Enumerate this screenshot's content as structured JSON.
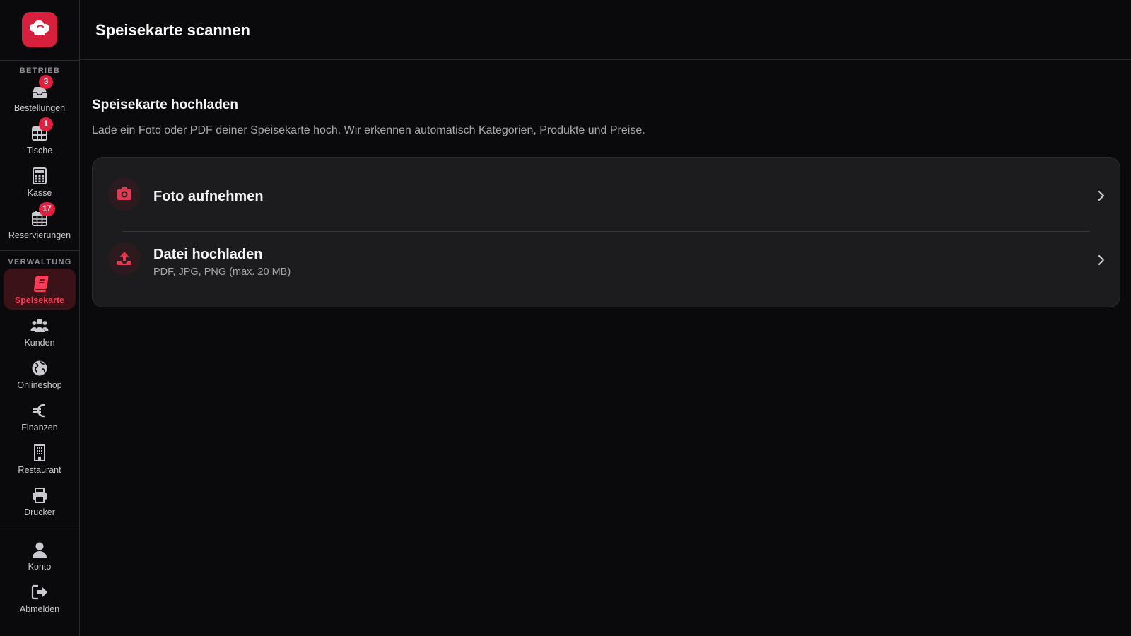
{
  "header": {
    "title": "Speisekarte scannen"
  },
  "sidebar": {
    "sections": {
      "betrieb": "BETRIEB",
      "verwaltung": "VERWALTUNG"
    },
    "items": [
      {
        "key": "bestellungen",
        "label": "Bestellungen",
        "icon": "inbox-icon",
        "badge": "3"
      },
      {
        "key": "tische",
        "label": "Tische",
        "icon": "table-grid-icon",
        "badge": "1"
      },
      {
        "key": "kasse",
        "label": "Kasse",
        "icon": "calculator-icon"
      },
      {
        "key": "reservierungen",
        "label": "Reservierungen",
        "icon": "calendar-icon",
        "badge": "17"
      },
      {
        "key": "speisekarte",
        "label": "Speisekarte",
        "icon": "menu-book-icon",
        "active": true
      },
      {
        "key": "kunden",
        "label": "Kunden",
        "icon": "users-icon"
      },
      {
        "key": "onlineshop",
        "label": "Onlineshop",
        "icon": "globe-icon"
      },
      {
        "key": "finanzen",
        "label": "Finanzen",
        "icon": "euro-icon"
      },
      {
        "key": "restaurant",
        "label": "Restaurant",
        "icon": "building-icon"
      },
      {
        "key": "drucker",
        "label": "Drucker",
        "icon": "printer-icon"
      },
      {
        "key": "konto",
        "label": "Konto",
        "icon": "user-icon"
      },
      {
        "key": "abmelden",
        "label": "Abmelden",
        "icon": "logout-icon"
      }
    ]
  },
  "main": {
    "section_title": "Speisekarte hochladen",
    "section_description": "Lade ein Foto oder PDF deiner Speisekarte hoch. Wir erkennen automatisch Kategorien, Produkte und Preise.",
    "options": [
      {
        "title": "Foto aufnehmen",
        "icon": "camera-icon"
      },
      {
        "title": "Datei hochladen",
        "subtitle": "PDF, JPG, PNG (max. 20 MB)",
        "icon": "upload-icon"
      }
    ]
  },
  "colors": {
    "accent": "#d6203e",
    "accent_text": "#ff3b57",
    "background": "#0a0a0c",
    "card": "#1c1c1f"
  }
}
